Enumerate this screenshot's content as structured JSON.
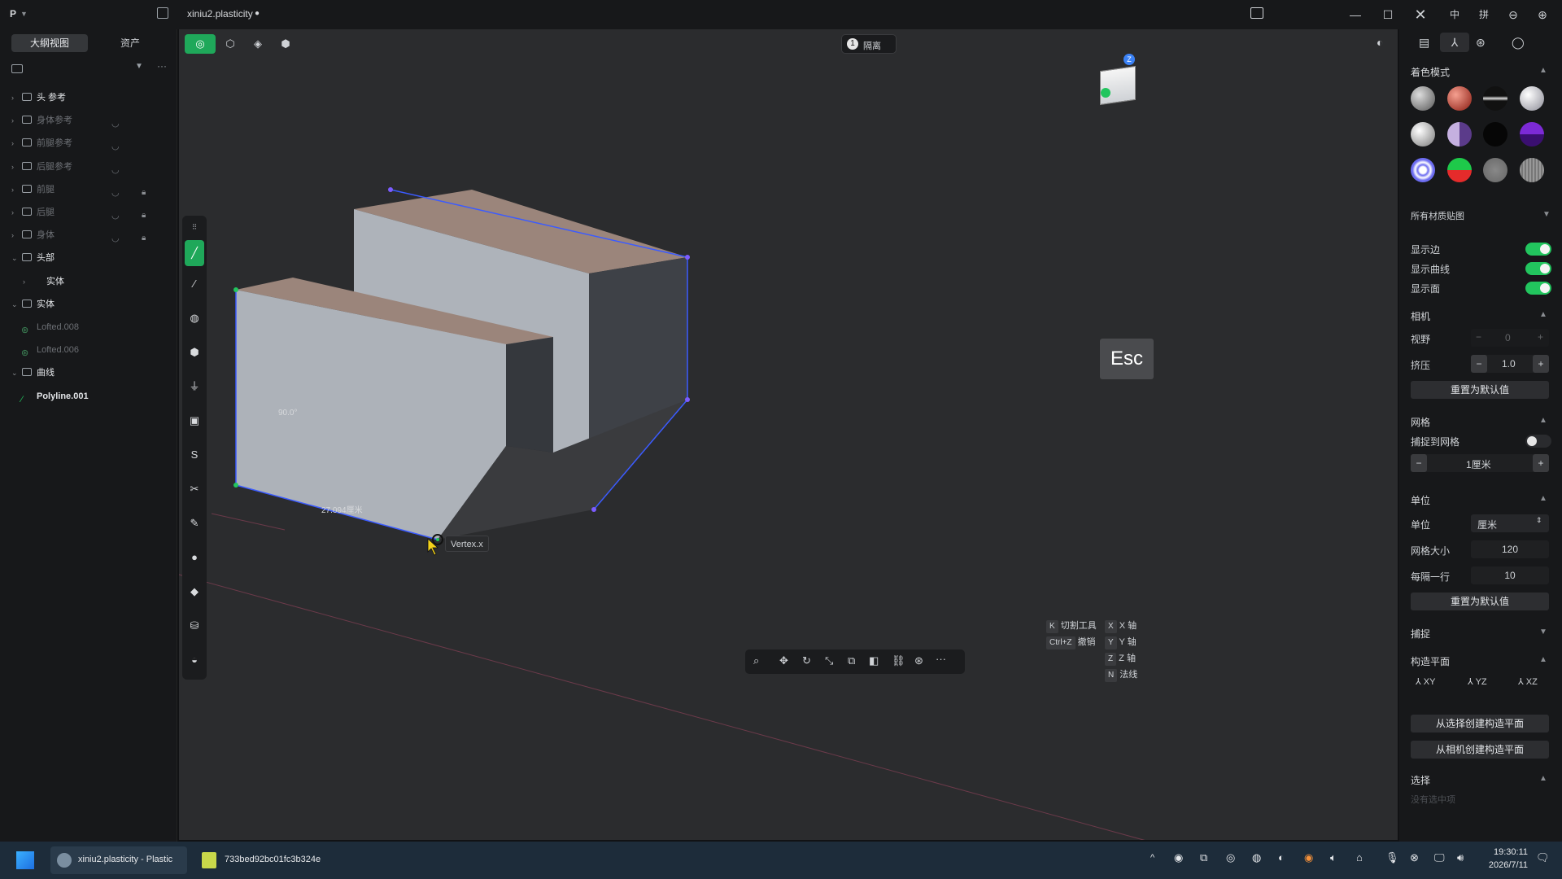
{
  "titlebar": {
    "app_icon": "P",
    "file_name": "xiniu2.plasticity",
    "unsaved_dot": "●",
    "ime_labels": [
      "中",
      "拼"
    ]
  },
  "sidebar": {
    "tabs": [
      {
        "label": "大纲视图",
        "active": true
      },
      {
        "label": "资产",
        "active": false
      }
    ],
    "items": [
      {
        "label": "头 参考",
        "indent": 0,
        "expanded": false,
        "dim": false,
        "eye": false,
        "lock": false
      },
      {
        "label": "身体参考",
        "indent": 0,
        "expanded": false,
        "dim": true,
        "eye": true,
        "lock": false
      },
      {
        "label": "前腿参考",
        "indent": 0,
        "expanded": false,
        "dim": true,
        "eye": true,
        "lock": false
      },
      {
        "label": "后腿参考",
        "indent": 0,
        "expanded": false,
        "dim": true,
        "eye": true,
        "lock": false
      },
      {
        "label": "前腿",
        "indent": 0,
        "expanded": false,
        "dim": true,
        "eye": true,
        "lock": true
      },
      {
        "label": "后腿",
        "indent": 0,
        "expanded": false,
        "dim": true,
        "eye": true,
        "lock": true
      },
      {
        "label": "身体",
        "indent": 0,
        "expanded": false,
        "dim": true,
        "eye": true,
        "lock": true
      },
      {
        "label": "头部",
        "indent": 0,
        "expanded": true,
        "dim": false,
        "eye": false,
        "lock": false
      },
      {
        "label": "实体",
        "indent": 1,
        "expanded": false,
        "dim": false,
        "eye": false,
        "lock": false
      },
      {
        "label": "实体",
        "indent": 0,
        "expanded": true,
        "dim": false,
        "eye": false,
        "lock": false
      },
      {
        "label": "Lofted.008",
        "indent": 1,
        "expanded": false,
        "dim": true,
        "eye": false,
        "lock": false
      },
      {
        "label": "Lofted.006",
        "indent": 1,
        "expanded": false,
        "dim": true,
        "eye": false,
        "lock": false
      },
      {
        "label": "曲线",
        "indent": 0,
        "expanded": true,
        "dim": false,
        "eye": false,
        "lock": false
      },
      {
        "label": "Polyline.001",
        "indent": 1,
        "expanded": false,
        "dim": false,
        "eye": false,
        "lock": false
      }
    ]
  },
  "viewport": {
    "isolate_label": "隔离",
    "isolate_number": "1",
    "angle_label": "90.0°",
    "length_label": "27.094厘米",
    "vertex_tooltip": "Vertex.x",
    "esc_key": "Esc",
    "shortcuts": [
      {
        "key": "K",
        "label": "切割工具"
      },
      {
        "key": "X",
        "label": "X 轴"
      },
      {
        "key": "Ctrl+Z",
        "label": "撤销"
      },
      {
        "key": "Y",
        "label": "Y 轴"
      },
      {
        "key": "Z",
        "label": "Z 轴"
      },
      {
        "key": "N",
        "label": "法线"
      }
    ],
    "gizmo_badge": "Z"
  },
  "rpanel": {
    "shading_title": "着色模式",
    "materials_label": "所有材质贴图",
    "show_edges": "显示边",
    "show_curves": "显示曲线",
    "show_faces": "显示面",
    "camera_title": "相机",
    "fov_label": "视野",
    "fov_value": "0",
    "extrude_label": "挤压",
    "extrude_value": "1.0",
    "reset_label": "重置为默认值",
    "grid_title": "网格",
    "snap_grid_label": "捕捉到网格",
    "grid_value": "1厘米",
    "units_title": "单位",
    "unit_label": "单位",
    "unit_value": "厘米",
    "grid_size_label": "网格大小",
    "grid_size_value": "120",
    "every_line_label": "每隔一行",
    "every_line_value": "10",
    "reset_label2": "重置为默认值",
    "snap_title": "捕捉",
    "cplane_title": "构造平面",
    "plane_xy": "XY",
    "plane_yz": "YZ",
    "plane_xz": "XZ",
    "from_selection": "从选择创建构造平面",
    "from_camera": "从相机创建构造平面",
    "select_title": "选择",
    "nothing_selected": "没有选中项"
  },
  "taskbar": {
    "app1": "xiniu2.plasticity - Plastic",
    "app2": "733bed92bc01fc3b324e",
    "time": "19:30:11",
    "date": "2026/7/11"
  },
  "colors": {
    "accent": "#22c55e",
    "edge_blue": "#3b5bff",
    "face_top": "#9b857b"
  }
}
